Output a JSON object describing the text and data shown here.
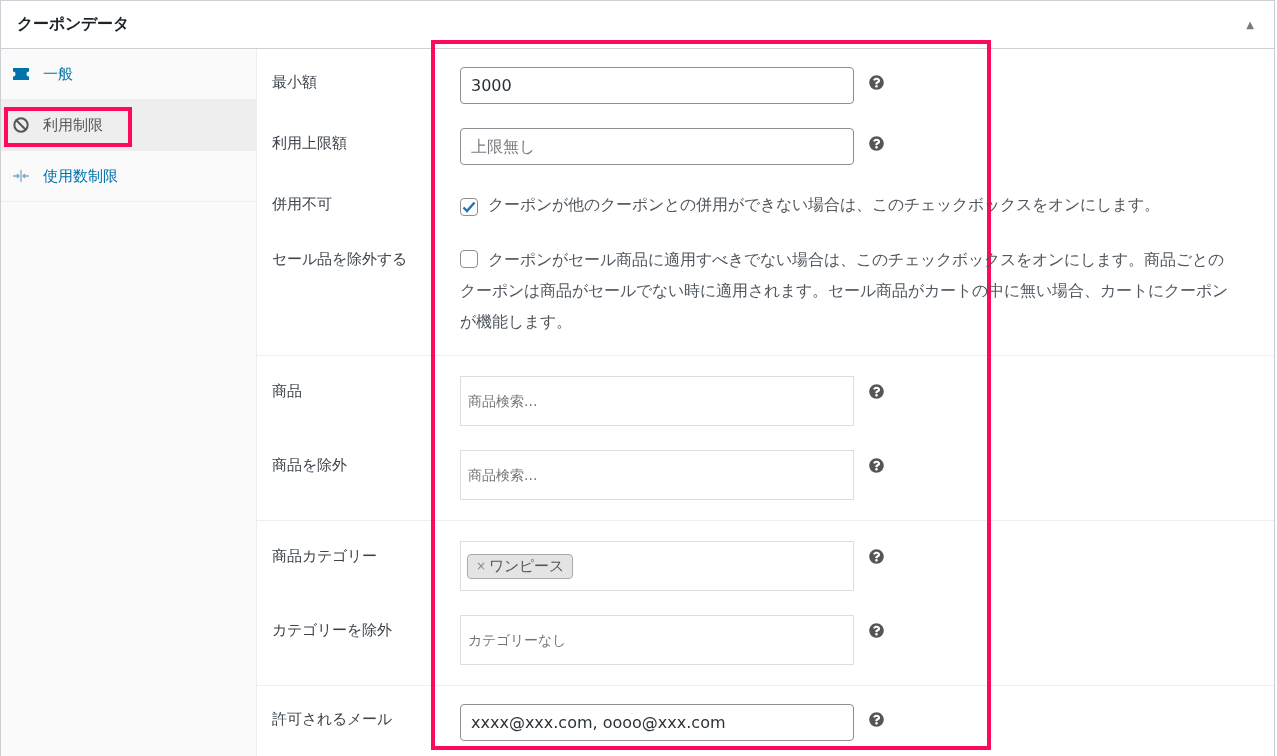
{
  "panel": {
    "title": "クーポンデータ",
    "collapse_icon": "▲"
  },
  "sidebar": {
    "items": [
      {
        "label": "一般",
        "selected": false,
        "highlighted": false
      },
      {
        "label": "利用制限",
        "selected": true,
        "highlighted": true
      },
      {
        "label": "使用数制限",
        "selected": false,
        "highlighted": false
      }
    ]
  },
  "sections": [
    {
      "rows": [
        {
          "kind": "text",
          "label": "最小額",
          "value": "3000"
        },
        {
          "kind": "text",
          "label": "利用上限額",
          "placeholder": "上限無し"
        },
        {
          "kind": "checkbox",
          "label": "併用不可",
          "checked": true,
          "description": "クーポンが他のクーポンとの併用ができない場合は、このチェックボックスをオンにします。"
        },
        {
          "kind": "checkbox",
          "label": "セール品を除外する",
          "checked": false,
          "description": "クーポンがセール商品に適用すべきでない場合は、このチェックボックスをオンにします。商品ごとのクーポンは商品がセールでない時に適用されます。セール商品がカートの中に無い場合、カートにクーポンが機能します。"
        }
      ]
    },
    {
      "rows": [
        {
          "kind": "select",
          "label": "商品",
          "placeholder": "商品検索..."
        },
        {
          "kind": "select",
          "label": "商品を除外",
          "placeholder": "商品検索..."
        }
      ]
    },
    {
      "rows": [
        {
          "kind": "select",
          "label": "商品カテゴリー",
          "tags": [
            {
              "remove": "×",
              "label": "ワンピース"
            }
          ]
        },
        {
          "kind": "select",
          "label": "カテゴリーを除外",
          "placeholder": "カテゴリーなし"
        }
      ]
    },
    {
      "rows": [
        {
          "kind": "text",
          "label": "許可されるメール",
          "value": "xxxx@xxx.com, oooo@xxx.com"
        }
      ]
    }
  ],
  "annotation": {
    "highlighted": true
  }
}
